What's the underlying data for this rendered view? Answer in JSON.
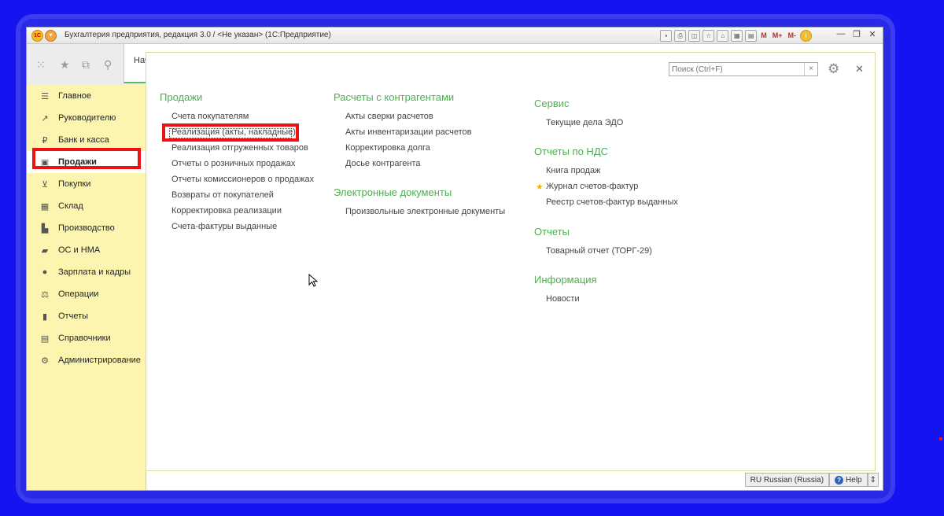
{
  "window": {
    "title": "Бухгалтерия предприятия, редакция 3.0 / <Не указан>  (1С:Предприятие)",
    "toolbar_text": [
      "M",
      "M+",
      "M-"
    ],
    "controls": [
      "—",
      "❐",
      "✕"
    ]
  },
  "tabs": {
    "start_label": "Нач"
  },
  "sidebar": {
    "items": [
      {
        "label": "Главное",
        "icon": "menu-icon"
      },
      {
        "label": "Руководителю",
        "icon": "chart-line-icon"
      },
      {
        "label": "Банк и касса",
        "icon": "ruble-coin-icon"
      },
      {
        "label": "Продажи",
        "icon": "shopping-bag-icon",
        "active": true
      },
      {
        "label": "Покупки",
        "icon": "cart-icon"
      },
      {
        "label": "Склад",
        "icon": "grid-boxes-icon"
      },
      {
        "label": "Производство",
        "icon": "factory-icon"
      },
      {
        "label": "ОС и НМА",
        "icon": "truck-icon"
      },
      {
        "label": "Зарплата и кадры",
        "icon": "person-icon"
      },
      {
        "label": "Операции",
        "icon": "balance-icon"
      },
      {
        "label": "Отчеты",
        "icon": "bar-chart-icon"
      },
      {
        "label": "Справочники",
        "icon": "book-icon"
      },
      {
        "label": "Администрирование",
        "icon": "gear-icon"
      }
    ]
  },
  "search": {
    "placeholder": "Поиск (Ctrl+F)"
  },
  "sections": {
    "sales": {
      "title": "Продажи",
      "links": [
        "Счета покупателям",
        "Реализация (акты, накладные)",
        "Реализация отгруженных товаров",
        "Отчеты о розничных продажах",
        "Отчеты комиссионеров о продажах",
        "Возвраты от покупателей",
        "Корректировка реализации",
        "Счета-фактуры выданные"
      ]
    },
    "settlements": {
      "title": "Расчеты с контрагентами",
      "links": [
        "Акты сверки расчетов",
        "Акты инвентаризации расчетов",
        "Корректировка долга",
        "Досье контрагента"
      ]
    },
    "edocs": {
      "title": "Электронные документы",
      "links": [
        "Произвольные электронные документы"
      ]
    },
    "service": {
      "title": "Сервис",
      "links": [
        "Текущие дела ЭДО"
      ]
    },
    "vat": {
      "title": "Отчеты по НДС",
      "links": [
        "Книга продаж",
        "Журнал счетов-фактур",
        "Реестр счетов-фактур выданных"
      ]
    },
    "reports": {
      "title": "Отчеты",
      "links": [
        "Товарный отчет (ТОРГ-29)"
      ]
    },
    "info": {
      "title": "Информация",
      "links": [
        "Новости"
      ]
    }
  },
  "statusbar": {
    "language": "RU Russian (Russia)",
    "help": "Help"
  }
}
